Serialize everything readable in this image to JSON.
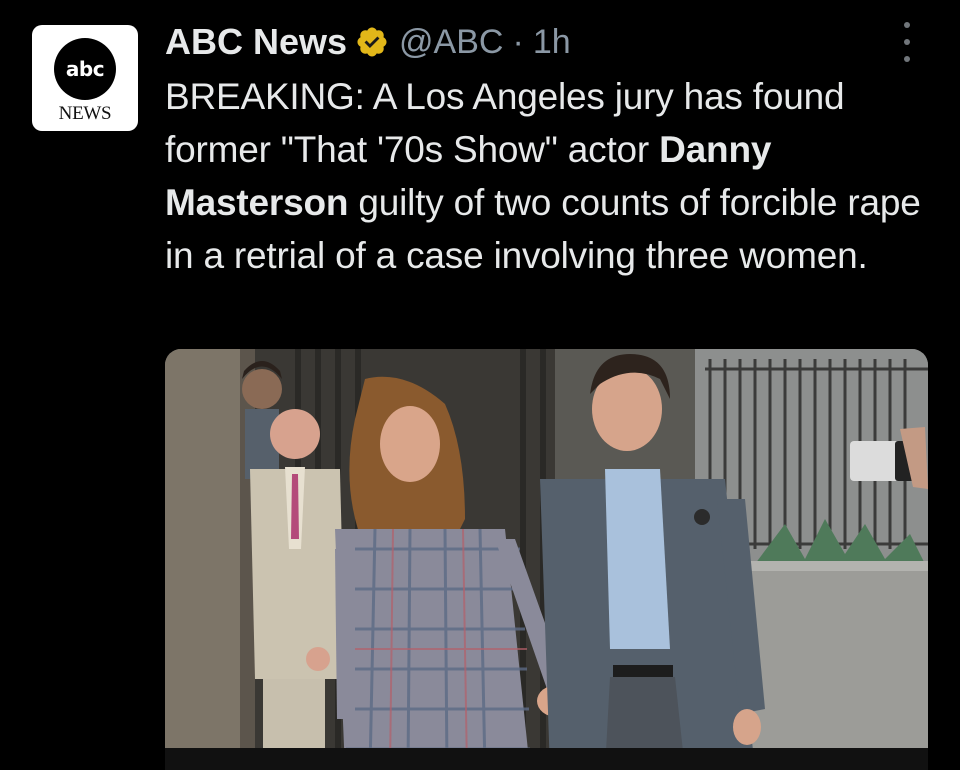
{
  "tweet": {
    "display_name": "ABC News",
    "handle": "@ABC",
    "separator": "·",
    "time": "1h",
    "body": {
      "part1": "BREAKING: A Los Angeles jury has found former \"That '70s Show\" actor ",
      "bold1": "Danny Masterson",
      "part2": " guilty of two counts of forcible rape in a retrial of a case involving three women."
    }
  },
  "avatar": {
    "circle_text": "abc",
    "word_text": "NEWS"
  },
  "icons": {
    "verified": "verified-badge-icon",
    "more": "more-options-icon"
  },
  "colors": {
    "background": "#000000",
    "text": "#e7e9ea",
    "secondary": "#8b98a5",
    "verified_gold": "#e2b719"
  }
}
